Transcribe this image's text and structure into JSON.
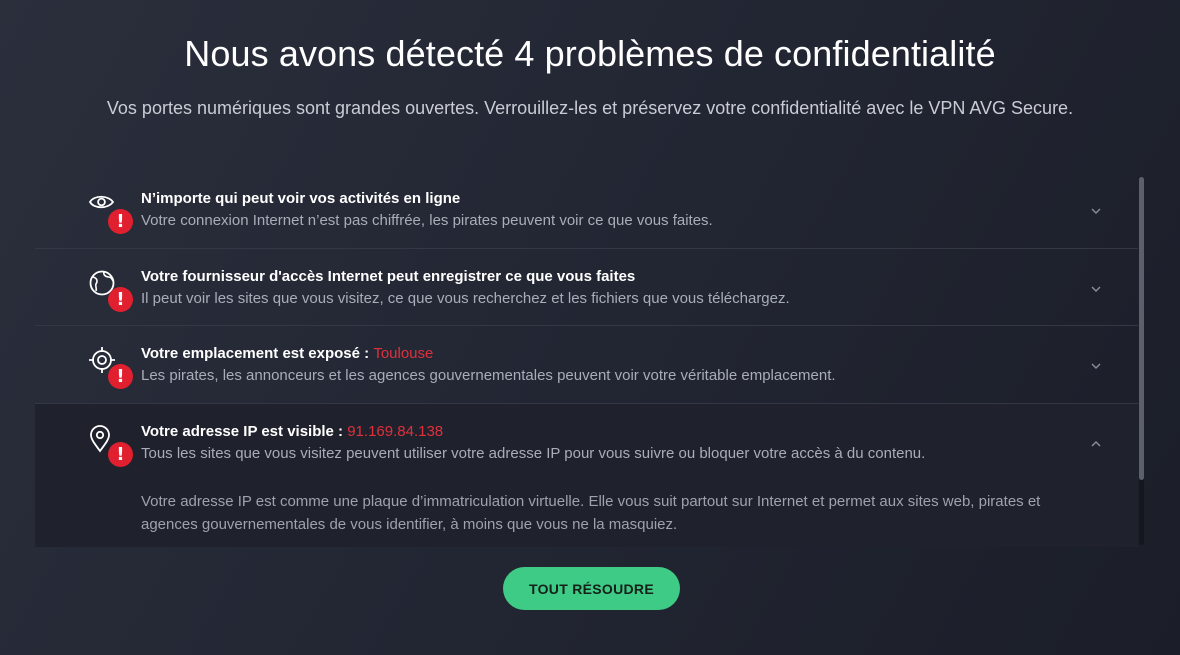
{
  "header": {
    "title": "Nous avons détecté 4 problèmes de confidentialité",
    "subtitle": "Vos portes numériques sont grandes ouvertes. Verrouillez-les et préservez votre confidentialité avec le VPN AVG Secure."
  },
  "issues": [
    {
      "icon": "eye-icon",
      "title": "N’importe qui peut voir vos activités en ligne",
      "highlight": "",
      "description": "Votre connexion Internet n’est pas chiffrée, les pirates peuvent voir ce que vous faites.",
      "expanded": false
    },
    {
      "icon": "globe-icon",
      "title": "Votre fournisseur d'accès Internet peut enregistrer ce que vous faites",
      "highlight": "",
      "description": "Il peut voir les sites que vous visitez, ce que vous recherchez et les fichiers que vous téléchargez.",
      "expanded": false
    },
    {
      "icon": "crosshair-icon",
      "title": "Votre emplacement est exposé : ",
      "highlight": "Toulouse",
      "description": "Les pirates, les annonceurs et les agences gouvernementales peuvent voir votre véritable emplacement.",
      "expanded": false
    },
    {
      "icon": "location-pin-icon",
      "title": "Votre adresse IP est visible : ",
      "highlight": "91.169.84.138",
      "description": "Tous les sites que vous visitez peuvent utiliser votre adresse IP pour vous suivre ou bloquer votre accès à du contenu.",
      "detail": "Votre adresse IP est comme une plaque d’immatriculation virtuelle. Elle vous suit partout sur Internet et permet aux sites web, pirates et agences gouvernementales de vous identifier, à moins que vous ne la masquiez.",
      "expanded": true
    }
  ],
  "alert_glyph": "!",
  "actions": {
    "resolve_all": "TOUT RÉSOUDRE"
  },
  "colors": {
    "accent_button": "#3ecb86",
    "alert": "#e0202e",
    "highlight_text": "#e0303c"
  }
}
